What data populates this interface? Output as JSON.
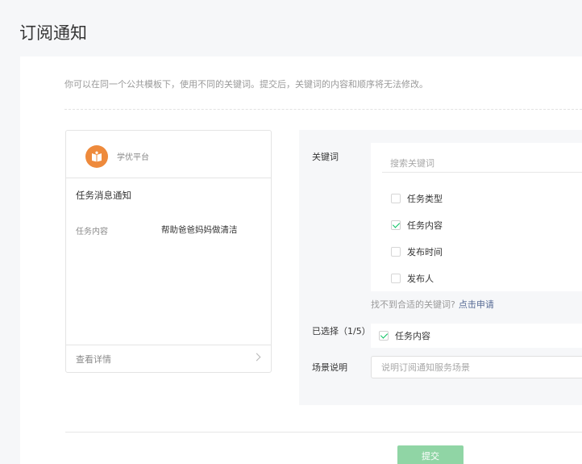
{
  "page": {
    "title": "订阅通知"
  },
  "tip": "你可以在同一个公共模板下，使用不同的关键词。提交后，关键词的内容和顺序将无法修改。",
  "preview": {
    "platform_name": "学优平台",
    "message_title": "任务消息通知",
    "field_label": "任务内容",
    "field_value": "帮助爸爸妈妈做清洁",
    "detail_link": "查看详情"
  },
  "form": {
    "keywords_label": "关键词",
    "search_placeholder": "搜索关键词",
    "options": [
      {
        "label": "任务类型",
        "checked": false
      },
      {
        "label": "任务内容",
        "checked": true
      },
      {
        "label": "发布时间",
        "checked": false
      },
      {
        "label": "发布人",
        "checked": false
      }
    ],
    "hint_text": "找不到合适的关键词?",
    "hint_link": "点击申请",
    "selected_label": "已选择（1/5）",
    "selected_items": [
      {
        "label": "任务内容",
        "checked": true
      }
    ],
    "scene_label": "场景说明",
    "scene_placeholder": "说明订阅通知服务场景"
  },
  "actions": {
    "submit_label": "提交"
  },
  "colors": {
    "accent_green": "#07c160",
    "submit_disabled": "#90d5a5",
    "link_blue": "#576b95",
    "logo_orange": "#ee8a3c"
  }
}
